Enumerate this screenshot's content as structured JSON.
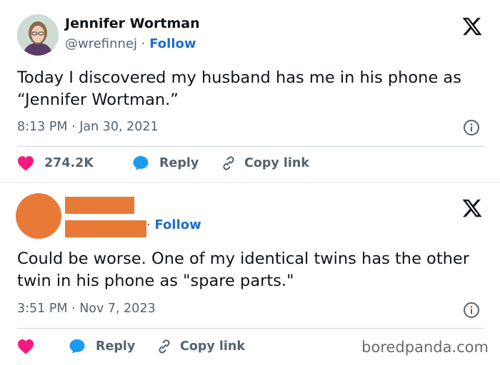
{
  "tweets": [
    {
      "author_name": "Jennifer Wortman",
      "handle": "@wrefinnej",
      "separator": "·",
      "follow_label": "Follow",
      "text": "Today I discovered my husband has me in his phone as “Jennifer Wortman.”",
      "timestamp": "8:13 PM · Jan 30, 2021",
      "like_count": "274.2K",
      "reply_label": "Reply",
      "copy_link_label": "Copy link"
    },
    {
      "author_redacted": true,
      "separator": "·",
      "follow_label": "Follow",
      "text": "Could be worse. One of my identical twins has the other twin in his phone as \"spare parts.\"",
      "timestamp": "3:51 PM · Nov 7, 2023",
      "reply_label": "Reply",
      "copy_link_label": "Copy link"
    }
  ],
  "watermark": "boredpanda.com",
  "colors": {
    "like": "#f91880",
    "reply": "#1d9bf0",
    "follow": "#1d6fc9",
    "redaction": "#e87a38",
    "muted_text": "#536471"
  },
  "icons": [
    "x-logo-icon",
    "info-icon",
    "heart-icon",
    "reply-bubble-icon",
    "link-icon"
  ]
}
